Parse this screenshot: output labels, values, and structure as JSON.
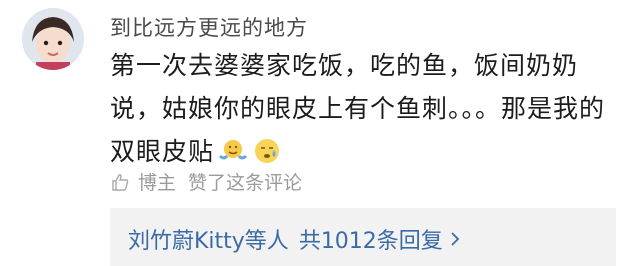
{
  "comment": {
    "username": "到比远方更远的地方",
    "text": "第一次去婆婆家吃饭，吃的鱼，饭间奶奶说，姑娘你的眼皮上有个鱼刺。。。那是我的双眼皮贴",
    "emojis": [
      "shrug-emoji-icon",
      "crying-face-emoji-icon"
    ]
  },
  "meta": {
    "author_label": "博主",
    "liked_text": "赞了这条评论"
  },
  "replies": {
    "summary": "刘竹蔚Kitty等人",
    "count_text": "共1012条回复",
    "arrow": ">"
  },
  "colors": {
    "username": "#4a4a4a",
    "link": "#3b6ba5",
    "meta": "#9b9b9b",
    "replies_bg": "#f2f2f2"
  }
}
